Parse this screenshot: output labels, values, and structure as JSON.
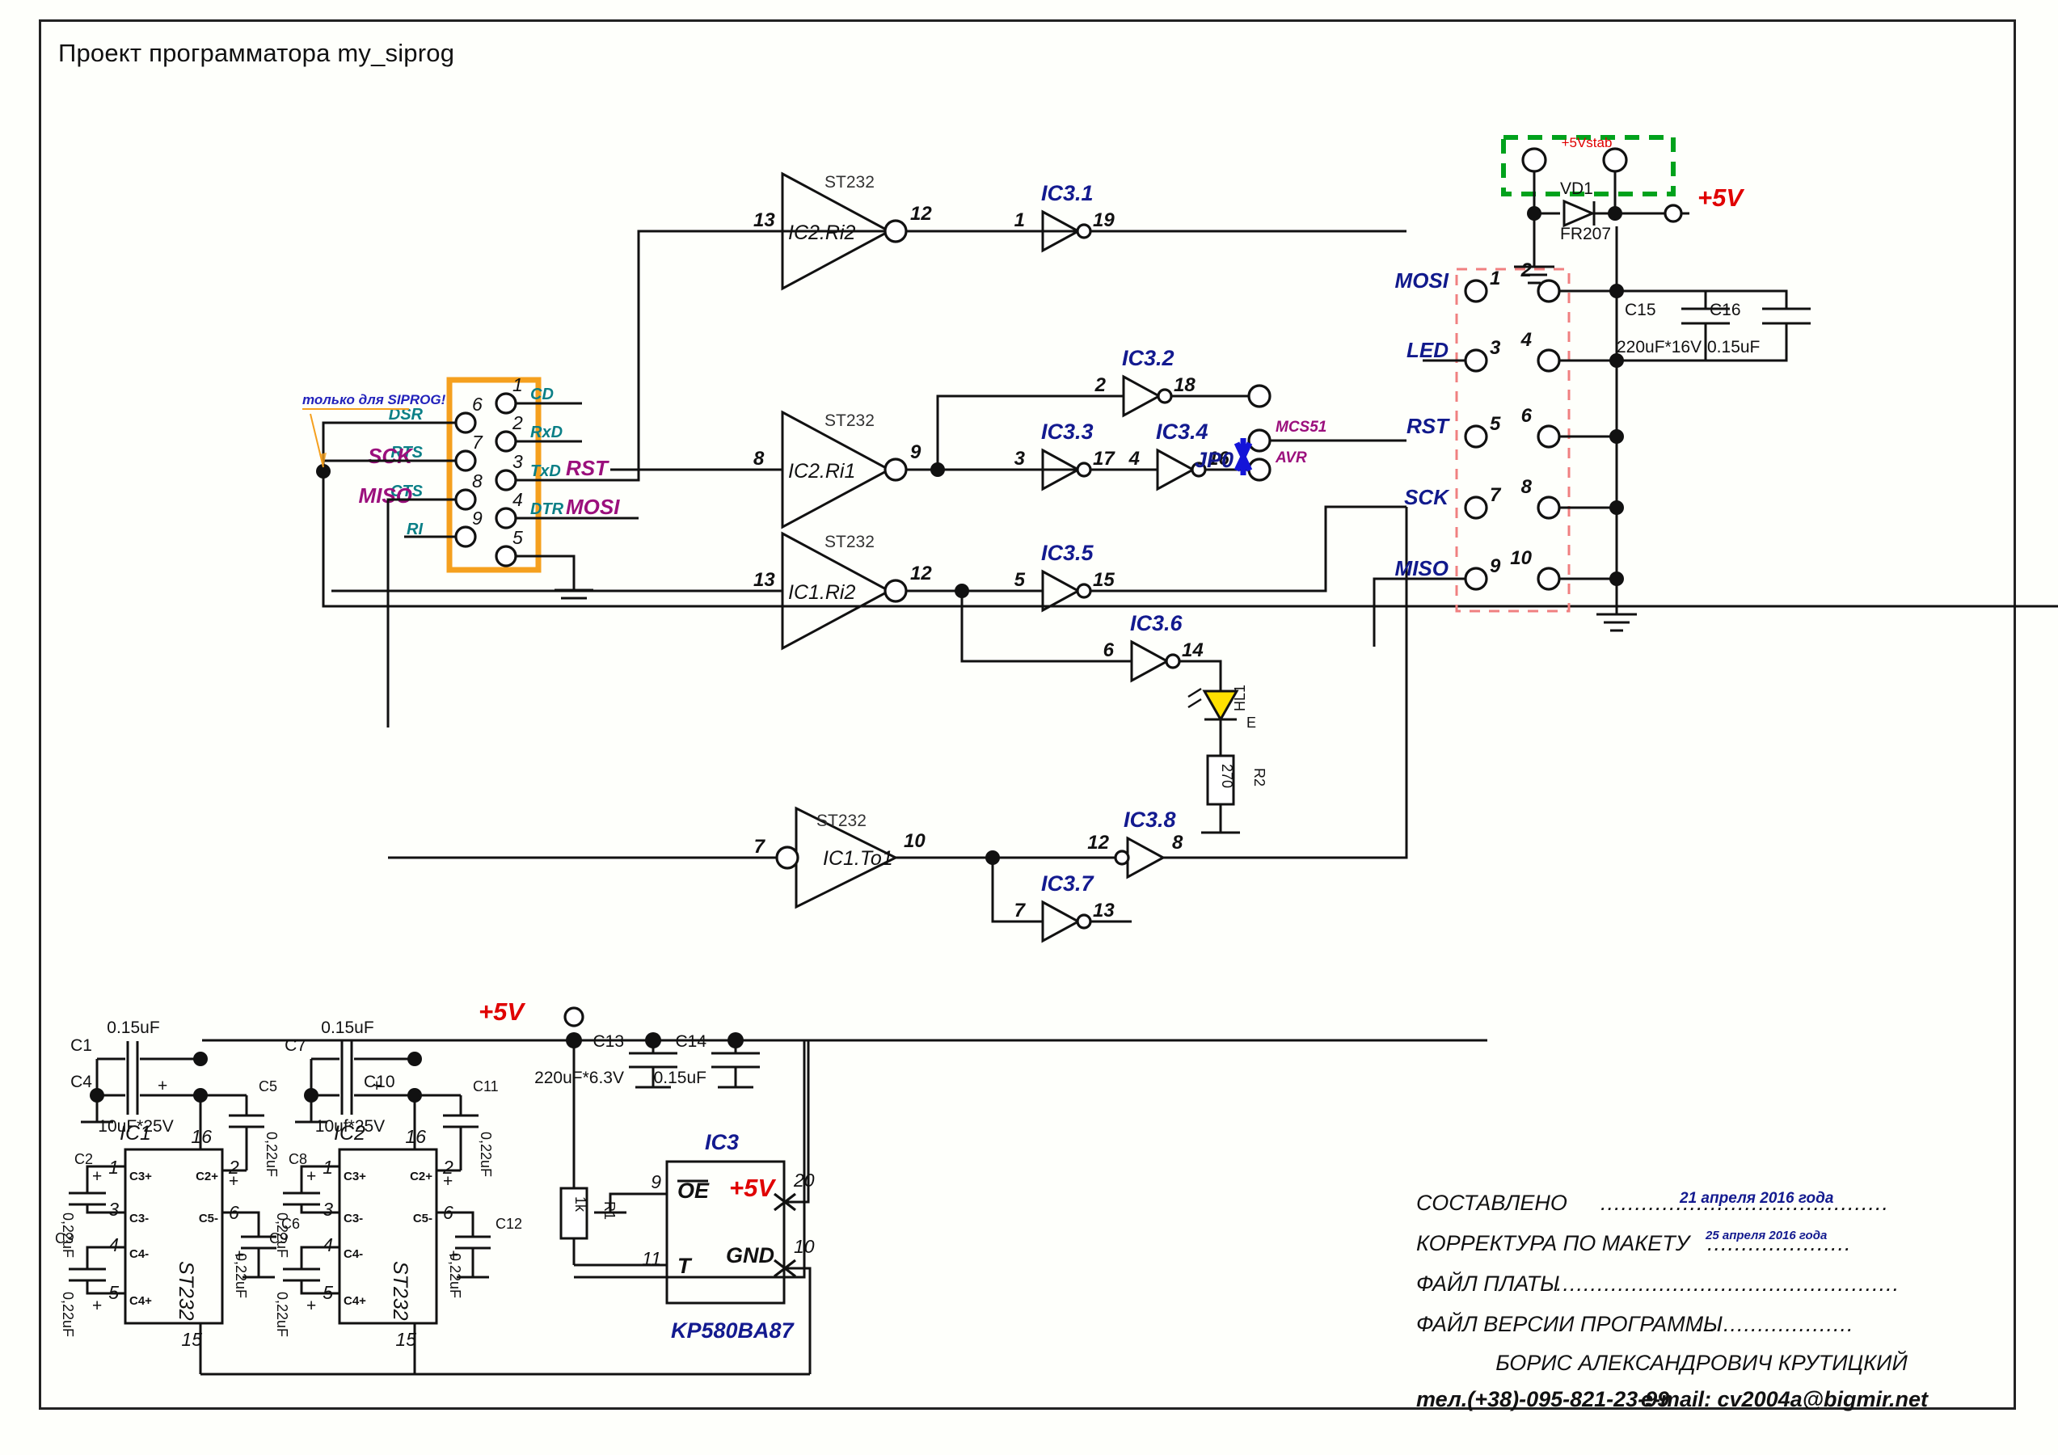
{
  "sheet": {
    "title": "Проект программатора my_siprog"
  },
  "db9": {
    "note": "только для SIPROG!",
    "left_pins": [
      {
        "num": "6",
        "sig": "DSR",
        "alt": ""
      },
      {
        "num": "7",
        "sig": "RTS",
        "alt": "SCK"
      },
      {
        "num": "8",
        "sig": "CTS",
        "alt": "MISO"
      },
      {
        "num": "9",
        "sig": "RI",
        "alt": ""
      }
    ],
    "right_pins": [
      {
        "num": "1",
        "sig": "CD",
        "alt": ""
      },
      {
        "num": "2",
        "sig": "RxD",
        "alt": ""
      },
      {
        "num": "3",
        "sig": "TxD",
        "alt": "RST"
      },
      {
        "num": "4",
        "sig": "DTR",
        "alt": "MOSI"
      },
      {
        "num": "5",
        "sig": "",
        "alt": ""
      }
    ]
  },
  "buffers": [
    {
      "name": "IC2.Ri2",
      "type": "ST232",
      "in": "13",
      "out": "12"
    },
    {
      "name": "IC2.Ri1",
      "type": "ST232",
      "in": "8",
      "out": "9"
    },
    {
      "name": "IC1.Ri2",
      "type": "ST232",
      "in": "13",
      "out": "12"
    },
    {
      "name": "IC1.To1",
      "type": "ST232",
      "in": "7",
      "out": "10"
    }
  ],
  "inverters": [
    {
      "name": "IC3.1",
      "in": "1",
      "out": "19"
    },
    {
      "name": "IC3.2",
      "in": "2",
      "out": "18"
    },
    {
      "name": "IC3.3",
      "in": "3",
      "out": "17"
    },
    {
      "name": "IC3.4",
      "in": "4",
      "out": "16"
    },
    {
      "name": "IC3.5",
      "in": "5",
      "out": "15"
    },
    {
      "name": "IC3.6",
      "in": "6",
      "out": "14"
    },
    {
      "name": "IC3.7",
      "in": "7",
      "out": "13"
    },
    {
      "name": "IC3.8",
      "in": "12",
      "out": "8"
    }
  ],
  "jumper": {
    "name": "JP0",
    "opt_top": "MCS51",
    "opt_bottom": "AVR"
  },
  "isp": {
    "pins": [
      {
        "num": "1",
        "label": "MOSI"
      },
      {
        "num": "2",
        "label": ""
      },
      {
        "num": "3",
        "label": "LED"
      },
      {
        "num": "4",
        "label": ""
      },
      {
        "num": "5",
        "label": "RST"
      },
      {
        "num": "6",
        "label": ""
      },
      {
        "num": "7",
        "label": "SCK"
      },
      {
        "num": "8",
        "label": ""
      },
      {
        "num": "9",
        "label": "MISO"
      },
      {
        "num": "10",
        "label": ""
      }
    ]
  },
  "power": {
    "stab_label": "+5Vstab",
    "rail_label": "+5V",
    "diode": {
      "ref": "VD1",
      "type": "FR207"
    },
    "caps": [
      {
        "ref": "C15",
        "value": "220uF*16V"
      },
      {
        "ref": "C16",
        "value": "0.15uF"
      }
    ]
  },
  "led": {
    "ref": "HL1",
    "pin": "E",
    "resistor": {
      "ref": "R2",
      "value": "270"
    }
  },
  "psu_bottom": {
    "rail_label": "+5V",
    "caps": [
      {
        "ref": "C13",
        "value": "220uF*6.3V"
      },
      {
        "ref": "C14",
        "value": "0.15uF"
      }
    ]
  },
  "ic1": {
    "ref": "IC1",
    "type": "ST232",
    "pins": {
      "p1": "1",
      "p2": "2",
      "p3": "3",
      "p4": "4",
      "p5": "5",
      "p6": "6",
      "p15": "15",
      "p16": "16"
    },
    "pinnames": {
      "c3p": "C3+",
      "c3m": "C3-",
      "c4m": "C4-",
      "c4p": "C4+",
      "c2p": "C2+",
      "c5m": "C5-"
    },
    "caps": [
      {
        "ref": "C1",
        "value": "0.15uF"
      },
      {
        "ref": "C4",
        "value": "10uF*25V"
      },
      {
        "ref": "C2",
        "value": "0,22uF"
      },
      {
        "ref": "C3",
        "value": "0,22uF"
      },
      {
        "ref": "C5",
        "value": "0,22uF"
      },
      {
        "ref": "C6",
        "value": "0,22uF"
      }
    ]
  },
  "ic2": {
    "ref": "IC2",
    "type": "ST232",
    "pins": {
      "p1": "1",
      "p2": "2",
      "p3": "3",
      "p4": "4",
      "p5": "5",
      "p6": "6",
      "p15": "15",
      "p16": "16"
    },
    "pinnames": {
      "c3p": "C3+",
      "c3m": "C3-",
      "c4m": "C4-",
      "c4p": "C4+",
      "c2p": "C2+",
      "c5m": "C5-"
    },
    "caps": [
      {
        "ref": "C7",
        "value": "0.15uF"
      },
      {
        "ref": "C10",
        "value": "10uf*25V"
      },
      {
        "ref": "C8",
        "value": "0,22uF"
      },
      {
        "ref": "C9",
        "value": "0,22uF"
      },
      {
        "ref": "C11",
        "value": "0,22uF"
      },
      {
        "ref": "C12",
        "value": "0,22uF"
      }
    ]
  },
  "ic3": {
    "ref": "IC3",
    "type": "KP580BA87",
    "pins": [
      {
        "num": "9",
        "name": "OE"
      },
      {
        "num": "11",
        "name": "T"
      },
      {
        "num": "20",
        "name": "+5V"
      },
      {
        "num": "10",
        "name": "GND"
      }
    ],
    "resistor": {
      "ref": "R1",
      "value": "1k"
    }
  },
  "titleblock": {
    "rows": [
      {
        "label": "СОСТАВЛЕНО",
        "value": "21 апреля 2016 года"
      },
      {
        "label": "КОРРЕКТУРА ПО МАКЕТУ",
        "value": "25 апреля  2016 года"
      },
      {
        "label": "ФАЙЛ ПЛАТЫ",
        "value": ""
      },
      {
        "label": "ФАЙЛ ВЕРСИИ ПРОГРАММЫ",
        "value": ""
      }
    ],
    "author": "БОРИС АЛЕКСАНДРОВИЧ КРУТИЦКИЙ",
    "phone": "тел.(+38)-095-821-23-99",
    "email": "e-mail: cv2004a@bigmir.net"
  },
  "colors": {
    "wire": "#111111",
    "ic_blue": "#131a8f",
    "teal": "#0a7f86",
    "magenta": "#9b0f7c",
    "red": "#e00000",
    "orange": "#f5a01e",
    "green": "#00a21c",
    "pinkdash": "#f08080",
    "led_yellow": "#ffe000"
  }
}
